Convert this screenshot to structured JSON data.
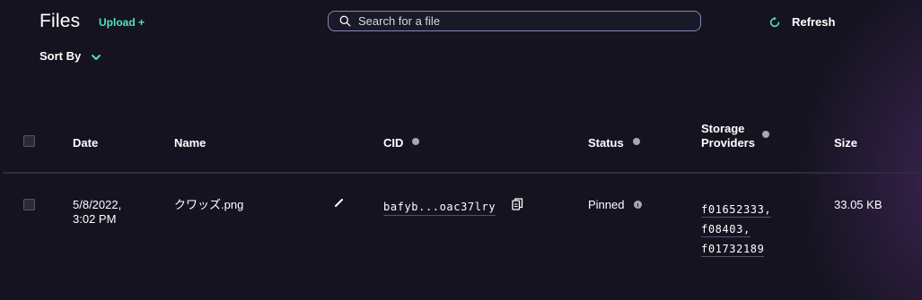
{
  "header": {
    "title": "Files",
    "upload_label": "Upload +",
    "refresh_label": "Refresh",
    "sort_by_label": "Sort By"
  },
  "search": {
    "placeholder": "Search for a file",
    "value": ""
  },
  "table": {
    "columns": {
      "date": "Date",
      "name": "Name",
      "cid": "CID",
      "status": "Status",
      "storage_providers_line1": "Storage",
      "storage_providers_line2": "Providers",
      "size": "Size"
    },
    "rows": [
      {
        "date_line1": "5/8/2022,",
        "date_line2": "3:02 PM",
        "name": "クワッズ.png",
        "cid": "bafyb...oac37lry",
        "status": "Pinned",
        "providers": [
          "f01652333,",
          "f08403,",
          "f01732189"
        ],
        "size": "33.05 KB"
      }
    ]
  },
  "colors": {
    "background": "#14131f",
    "accent": "#4fe3c1",
    "search_border": "#8a86b8"
  },
  "icons": {
    "search": "search-icon",
    "refresh": "refresh-icon",
    "sort": "chevron-down-icon",
    "info": "info-icon",
    "edit": "pencil-icon",
    "copy": "copy-icon"
  }
}
